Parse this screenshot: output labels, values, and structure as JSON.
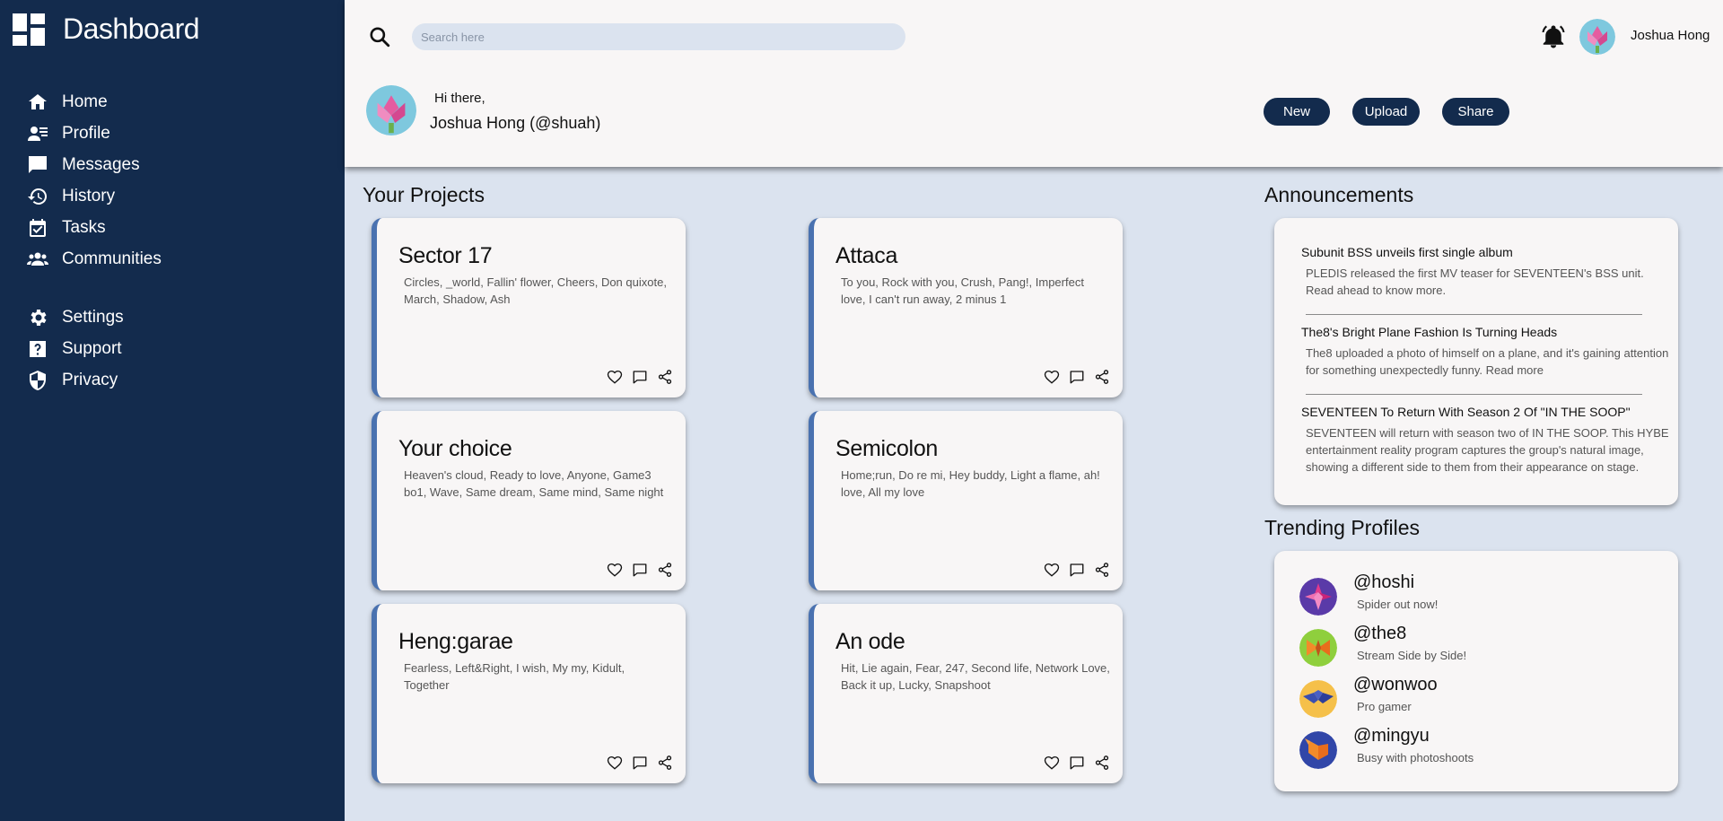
{
  "app": {
    "title": "Dashboard"
  },
  "nav": {
    "items": [
      {
        "label": "Home"
      },
      {
        "label": "Profile"
      },
      {
        "label": "Messages"
      },
      {
        "label": "History"
      },
      {
        "label": "Tasks"
      },
      {
        "label": "Communities"
      },
      {
        "label": "Settings"
      },
      {
        "label": "Support"
      },
      {
        "label": "Privacy"
      }
    ]
  },
  "search": {
    "placeholder": "Search here"
  },
  "user": {
    "name": "Joshua Hong"
  },
  "greeting": {
    "hi": "Hi there,",
    "name": "Joshua Hong (@shuah)"
  },
  "actions": {
    "new": "New",
    "upload": "Upload",
    "share": "Share"
  },
  "projects": {
    "title": "Your Projects",
    "items": [
      {
        "title": "Sector 17",
        "songs": "Circles, _world, Fallin' flower, Cheers, Don quixote, March, Shadow, Ash"
      },
      {
        "title": "Attaca",
        "songs": "To you, Rock with you, Crush, Pang!, Imperfect love, I can't run away, 2 minus 1"
      },
      {
        "title": "Your choice",
        "songs": "Heaven's cloud, Ready to love, Anyone, Game3 bo1, Wave, Same dream, Same mind, Same night"
      },
      {
        "title": "Semicolon",
        "songs": "Home;run, Do re mi, Hey buddy, Light a flame, ah! love, All my love"
      },
      {
        "title": "Heng:garae",
        "songs": "Fearless, Left&Right, I wish, My my, Kidult, Together"
      },
      {
        "title": "An ode",
        "songs": "Hit, Lie again, Fear, 247, Second life, Network Love, Back it up, Lucky, Snapshoot"
      }
    ]
  },
  "announcements": {
    "title": "Announcements",
    "items": [
      {
        "title": "Subunit BSS unveils first single album",
        "body": "PLEDIS released the first MV teaser for SEVENTEEN's BSS unit. Read ahead to know more."
      },
      {
        "title": "The8's Bright Plane Fashion Is Turning Heads",
        "body": "The8 uploaded a photo of himself on a plane, and it's gaining attention for something unexpectedly funny. Read more"
      },
      {
        "title": "SEVENTEEN To Return With Season 2 Of \"IN THE SOOP\"",
        "body": "SEVENTEEN will return with season two of IN THE SOOP. This HYBE entertainment reality program captures the group's natural image, showing a different side to them from their appearance on stage."
      }
    ]
  },
  "trending": {
    "title": "Trending Profiles",
    "items": [
      {
        "handle": "@hoshi",
        "status": "Spider out now!",
        "color": "#5a3aa8"
      },
      {
        "handle": "@the8",
        "status": "Stream Side by Side!",
        "color": "#8fcf3d"
      },
      {
        "handle": "@wonwoo",
        "status": "Pro gamer",
        "color": "#f5c04a"
      },
      {
        "handle": "@mingyu",
        "status": "Busy with photoshoots",
        "color": "#3146a8"
      }
    ]
  },
  "colors": {
    "sidebar": "#132b4d",
    "accent": "#4a72b0",
    "background": "#dbe3ef",
    "surface": "#f8f6f6"
  }
}
